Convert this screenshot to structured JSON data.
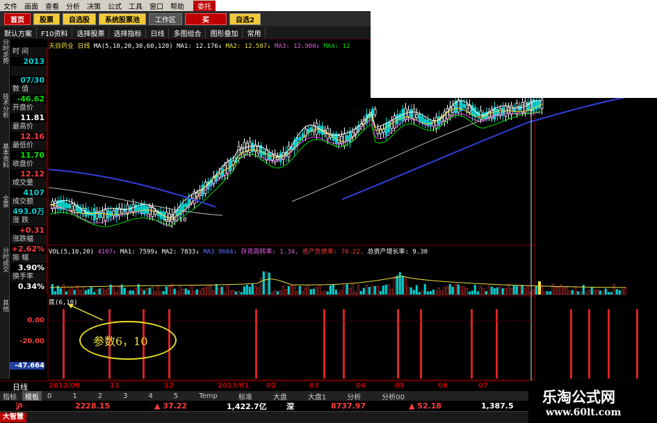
{
  "menu": [
    "文件",
    "画面",
    "查看",
    "分析",
    "决策",
    "公式",
    "工具",
    "窗口",
    "帮助",
    "委托"
  ],
  "toolbar": {
    "home": "首页",
    "stocks": "股票",
    "watchlist": "自选股",
    "system": "系统股票池",
    "workspace": "工作区",
    "buy": "买",
    "watch2": "自选2"
  },
  "subbar": [
    "默认方案",
    "F10资料",
    "选择股票",
    "选择指标",
    "日线",
    "多图组合",
    "图形叠加",
    "常用"
  ],
  "left_tabs": [
    "分时走势",
    "技术分析",
    "基本资料",
    "全景",
    "分时成交",
    "其他"
  ],
  "side": [
    {
      "label": "时  间",
      "value": "2013",
      "color": "cyan"
    },
    {
      "label": "",
      "value": "07/30",
      "color": "cyan"
    },
    {
      "label": "数  值",
      "value": "-46.62",
      "color": "green"
    },
    {
      "label": "开盘价",
      "value": "11.81",
      "color": "white"
    },
    {
      "label": "最高价",
      "value": "12.16",
      "color": "red"
    },
    {
      "label": "最低价",
      "value": "11.70",
      "color": "green"
    },
    {
      "label": "收盘价",
      "value": "12.12",
      "color": "red"
    },
    {
      "label": "成交量",
      "value": "4107",
      "color": "cyan"
    },
    {
      "label": "成交额",
      "value": "493.0万",
      "color": "cyan"
    },
    {
      "label": "涨  跌",
      "value": "+0.31",
      "color": "red"
    },
    {
      "label": "涨跌幅",
      "value": "+2.62%",
      "color": "red"
    },
    {
      "label": "振  幅",
      "value": "3.90%",
      "color": "white"
    },
    {
      "label": "换手率",
      "value": "0.34%",
      "color": "white"
    }
  ],
  "title_main": {
    "name": "天目药业",
    "period": "日线",
    "ma": "MA(5,10,20,30,60,120)",
    "ma1": "MA1: 12.176↓",
    "ma2": "MA2: 12.507↓",
    "ma3": "MA3: 12.900↓",
    "ma4": "MA4: 12"
  },
  "title_vol": {
    "vol": "VOL(5,10,20)",
    "v": "4107↓",
    "ma1": "MA1: 7599↓",
    "ma2": "MA2: 7833↓",
    "ma3": "MA3",
    "ma3v": "9604↓",
    "turn": "存货周转率: 1.34,",
    "debt": "资产负债率: 70.22,",
    "growth": "总资产增长率: 9.30"
  },
  "title_ind": "底(6,10)",
  "ind_axis": [
    "0.00",
    "-20.00",
    "-47.664"
  ],
  "price_low_label": "←-7.10",
  "note": "参数6，10",
  "dates": {
    "daily": "日线",
    "ticks": [
      "2012/09",
      "11",
      "12",
      "2013/01",
      "02",
      "03",
      "04",
      "05",
      "06",
      "07"
    ]
  },
  "tabs": [
    "指标",
    "模板",
    "0",
    "1",
    "2",
    "3",
    "4",
    "5",
    "Temp",
    "标准",
    "大盘",
    "大盘1",
    "分析",
    "分析00"
  ],
  "ticker": {
    "sh": "沪",
    "sh_val": "2228.15",
    "sh_chg": "▲ 37.22",
    "sh_amt": "1,422.7亿",
    "sz": "深",
    "sz_val": "8737.97",
    "sz_chg": "▲ 52.18",
    "sz_amt": "1,387.5"
  },
  "brand": "大智慧",
  "watermark": {
    "title": "乐淘公式网",
    "url": "www.60lt.com"
  },
  "colors": {
    "up": "#ff3c3c",
    "down": "#00e000",
    "accent": "#c00000",
    "ma_blue": "#3040e0"
  }
}
